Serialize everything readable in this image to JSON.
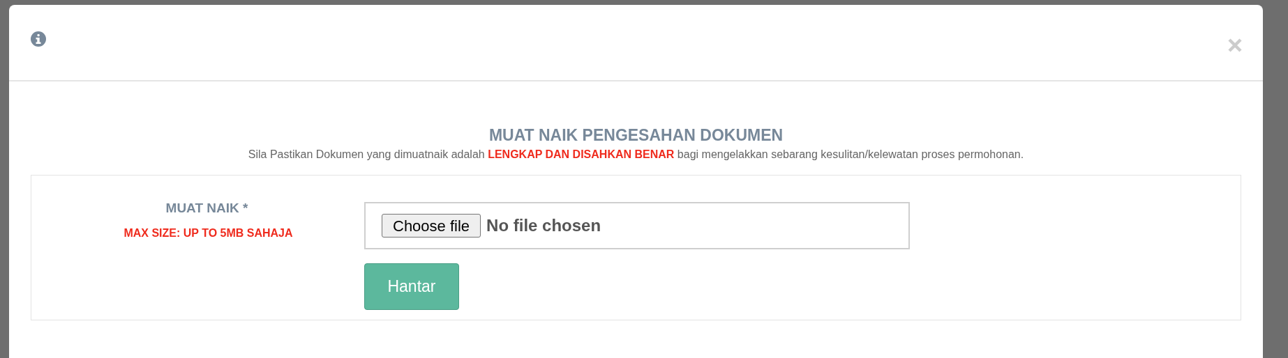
{
  "modal": {
    "title": "MUAT NAIK PENGESAHAN DOKUMEN",
    "instruction": "Sila Pastikan Dokumen yang dimuatnaik adalah **LENGKAP DAN DISAHKAN BENAR** bagi mengelakkan sebarang kesulitan/kelewatan proses permohonan.",
    "form": {
      "label": "MUAT NAIK *",
      "hint": "MAX SIZE: UP TO 5MB SAHAJA",
      "file_input": {
        "button": "Choose file",
        "status": "No file chosen"
      },
      "submit": "Hantar"
    }
  }
}
